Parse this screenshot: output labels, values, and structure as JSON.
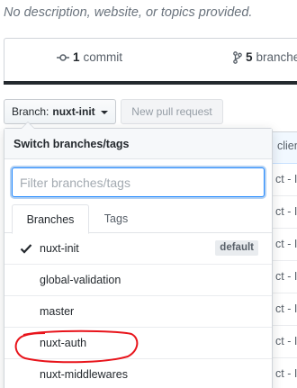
{
  "repo": {
    "description": "No description, website, or topics provided."
  },
  "stats": {
    "commits_count": "1",
    "commits_label": "commit",
    "branches_count": "5",
    "branches_label": "branches"
  },
  "toolbar": {
    "branch_prefix": "Branch:",
    "branch_name": "nuxt-init",
    "new_pr_label": "New pull request"
  },
  "branch_menu": {
    "header": "Switch branches/tags",
    "filter_placeholder": "Filter branches/tags",
    "tabs": [
      {
        "label": "Branches",
        "selected": true
      },
      {
        "label": "Tags",
        "selected": false
      }
    ],
    "items": [
      {
        "name": "nuxt-init",
        "selected": true,
        "badge": "default"
      },
      {
        "name": "global-validation",
        "selected": false
      },
      {
        "name": "master",
        "selected": false
      },
      {
        "name": "nuxt-auth",
        "selected": false
      },
      {
        "name": "nuxt-middlewares",
        "selected": false,
        "annotated": true
      }
    ]
  },
  "background_list": {
    "header": "client",
    "rows": [
      "ct - I",
      "ct - I",
      "ct - I",
      "ct - I",
      "ct - I",
      "ct - I",
      "ct - I"
    ]
  },
  "colors": {
    "focus_blue": "#2188ff",
    "annotation_red": "#e8141b",
    "stats_bar": "#24292e"
  },
  "icons": {
    "commit": "git-commit-icon",
    "branch": "git-branch-icon",
    "check": "check-icon",
    "caret": "triangle-down-icon"
  }
}
